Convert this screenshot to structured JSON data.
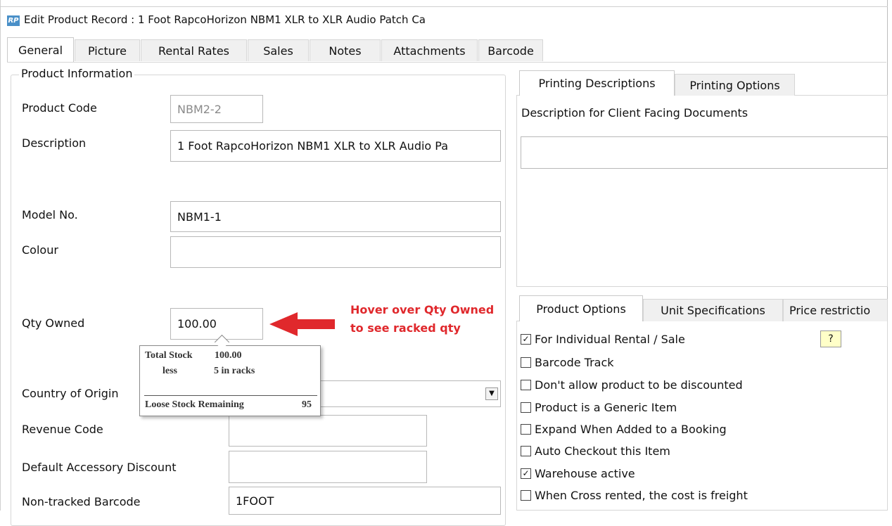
{
  "window": {
    "title": "Edit Product Record : 1 Foot RapcoHorizon NBM1 XLR to XLR Audio Patch Ca",
    "app_icon": "RP"
  },
  "tabs": [
    "General",
    "Picture",
    "Rental Rates",
    "Sales",
    "Notes",
    "Attachments",
    "Barcode"
  ],
  "product_info": {
    "group_title": "Product Information",
    "product_code_label": "Product Code",
    "product_code_value": "NBM2-2",
    "description_label": "Description",
    "description_value": "1 Foot RapcoHorizon NBM1 XLR to XLR Audio Pa",
    "model_no_label": "Model No.",
    "model_no_value": "NBM1-1",
    "colour_label": "Colour",
    "colour_value": "",
    "qty_owned_label": "Qty Owned",
    "qty_owned_value": "100.00",
    "country_label": "Country of Origin",
    "country_value": "",
    "revenue_code_label": "Revenue Code",
    "revenue_code_value": "",
    "default_discount_label": "Default Accessory Discount",
    "default_discount_value": "",
    "barcode_label": "Non-tracked Barcode",
    "barcode_value": "1FOOT"
  },
  "tooltip": {
    "total_stock_label": "Total Stock",
    "total_stock_value": "100.00",
    "less_label": "less",
    "racks_text": "5 in racks",
    "remaining_label": "Loose Stock Remaining",
    "remaining_value": "95"
  },
  "annotation": {
    "line1": "Hover over Qty Owned",
    "line2": "to see racked qty",
    "color": "#e0282c"
  },
  "printing": {
    "tabs": [
      "Printing Descriptions",
      "Printing Options"
    ],
    "description_label": "Description for Client Facing Documents",
    "description_value": ""
  },
  "options": {
    "tabs": [
      "Product Options",
      "Unit Specifications",
      "Price restrictio"
    ],
    "help_label": "?",
    "items": [
      {
        "label": "For Individual Rental / Sale",
        "checked": true
      },
      {
        "label": "Barcode Track",
        "checked": false
      },
      {
        "label": "Don't allow product to be discounted",
        "checked": false
      },
      {
        "label": "Product is a Generic Item",
        "checked": false
      },
      {
        "label": "Expand When Added to a Booking",
        "checked": false
      },
      {
        "label": "Auto Checkout this Item",
        "checked": false
      },
      {
        "label": "Warehouse active",
        "checked": true
      },
      {
        "label": "When Cross rented, the cost is freight",
        "checked": false
      }
    ]
  },
  "icons": {
    "dropdown": "chevron-down-icon",
    "arrow": "arrow-left-icon",
    "check": "check-icon"
  }
}
